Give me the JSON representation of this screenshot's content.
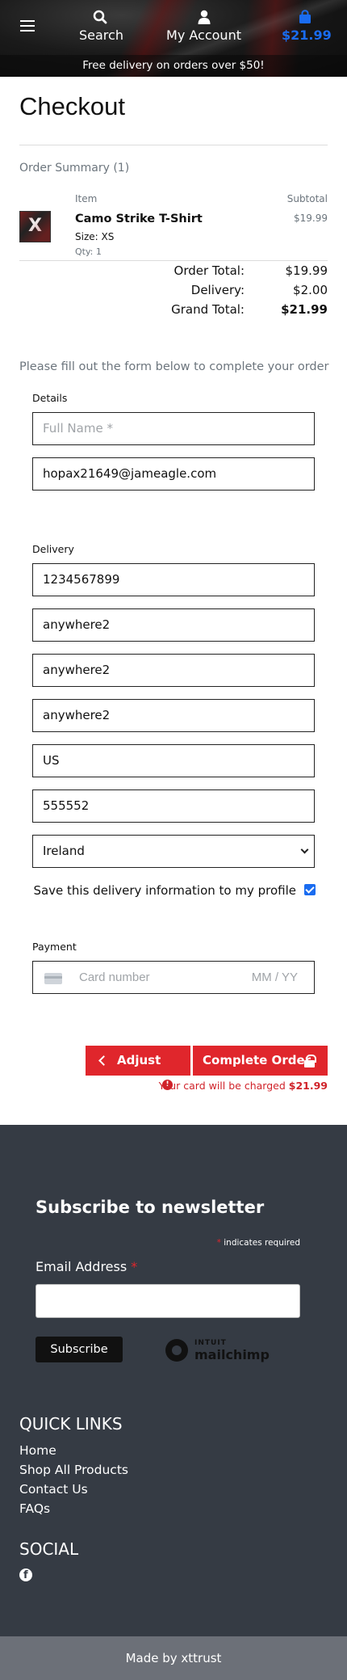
{
  "header": {
    "search_label": "Search",
    "account_label": "My Account",
    "cart_total": "$21.99",
    "delivery_banner": "Free delivery on orders over $50!"
  },
  "checkout": {
    "title": "Checkout",
    "order_summary": "Order Summary (1)",
    "col_item": "Item",
    "col_subtotal": "Subtotal",
    "item": {
      "name": "Camo Strike T-Shirt",
      "size": "Size: XS",
      "qty": "Qty: 1",
      "price": "$19.99"
    },
    "totals": {
      "order_total_label": "Order Total:",
      "order_total": "$19.99",
      "delivery_label": "Delivery:",
      "delivery": "$2.00",
      "grand_total_label": "Grand Total:",
      "grand_total": "$21.99"
    },
    "fill_message": "Please fill out the form below to complete your order",
    "details_label": "Details",
    "full_name_placeholder": "Full Name *",
    "email_value": "hopax21649@jameagle.com",
    "delivery_label": "Delivery",
    "phone_value": "1234567899",
    "address_line1": "anywhere2",
    "address_line2": "anywhere2",
    "town_city": "anywhere2",
    "county": "US",
    "postcode": "555552",
    "country": "Ireland",
    "save_info_label": "Save this delivery information to my profile",
    "payment_label": "Payment",
    "card_number_placeholder": "Card number",
    "card_expiry_placeholder": "MM / YY",
    "adjust_bag_label": "Adjust Bag",
    "complete_order_label": "Complete Order",
    "charge_note_prefix": "Your card will be charged",
    "charge_amount": "$21.99"
  },
  "footer": {
    "newsletter_title": "Subscribe to newsletter",
    "required_note": "indicates required",
    "email_label": "Email Address",
    "subscribe_label": "Subscribe",
    "mailchimp_top": "INTUIT",
    "mailchimp_bottom": "mailchimp",
    "quick_links_title": "QUICK LINKS",
    "quick_links": [
      "Home",
      "Shop All Products",
      "Contact Us",
      "FAQs"
    ],
    "social_title": "SOCIAL",
    "made_by": "Made by xttrust"
  },
  "colors": {
    "accent_red": "#e0262c",
    "cart_blue": "#1a6cf0",
    "footer_bg": "#353b44"
  }
}
